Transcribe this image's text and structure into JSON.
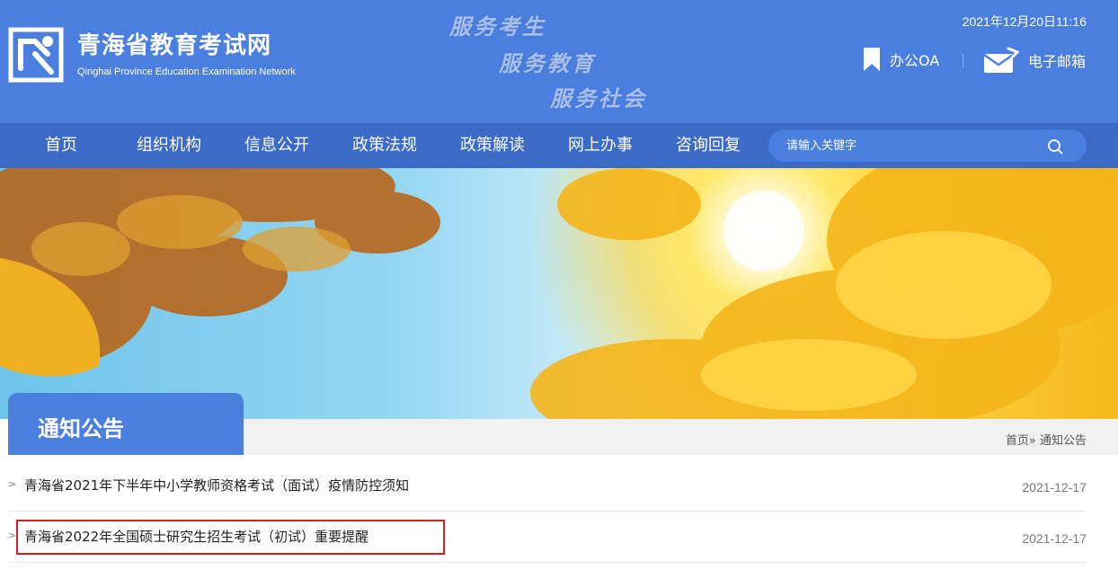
{
  "header": {
    "site_title": "青海省教育考试网",
    "site_subtitle": "Qinghai Province Education Examination Network",
    "slogans": [
      "服务考生",
      "服务教育",
      "服务社会"
    ],
    "datetime": "2021年12月20日11:16",
    "links": {
      "oa": "办公OA",
      "mail": "电子邮箱"
    },
    "icons": {
      "logo": "qinghai-exam-logo",
      "oa": "bookmark-icon",
      "mail": "mail-icon"
    },
    "brand_color": "#4a7fe0",
    "nav_color": "#3b6bc7"
  },
  "nav": {
    "items": [
      "首页",
      "组织机构",
      "信息公开",
      "政策法规",
      "政策解读",
      "网上办事",
      "咨询回复"
    ],
    "search_placeholder": "请输入关键字",
    "search_icon": "search-icon"
  },
  "section": {
    "title": "通知公告",
    "breadcrumb": {
      "home": "首页",
      "sep": "»",
      "current": "通知公告"
    }
  },
  "news": [
    {
      "bullet": ">",
      "title": "青海省2021年下半年中小学教师资格考试（面试）疫情防控须知",
      "date": "2021-12-17"
    },
    {
      "bullet": ">",
      "title": "青海省2022年全国硕士研究生招生考试（初试）重要提醒",
      "date": "2021-12-17",
      "highlighted": true
    }
  ],
  "highlight_color": "#d42020"
}
